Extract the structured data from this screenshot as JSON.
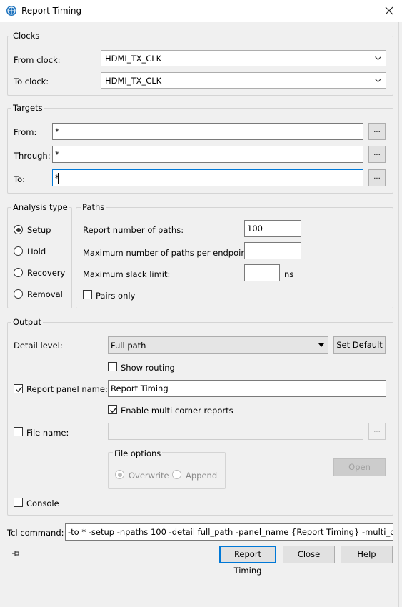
{
  "window": {
    "title": "Report Timing",
    "icon": "globe-app-icon",
    "close_icon": "close-icon"
  },
  "clocks": {
    "legend": "Clocks",
    "from_label": "From clock:",
    "from_value": "HDMI_TX_CLK",
    "to_label": "To clock:",
    "to_value": "HDMI_TX_CLK"
  },
  "targets": {
    "legend": "Targets",
    "from_label": "From:",
    "from_value": "*",
    "through_label": "Through:",
    "through_value": "*",
    "to_label": "To:",
    "to_value": "*",
    "browse_label": "..."
  },
  "analysis": {
    "legend": "Analysis type",
    "options": [
      "Setup",
      "Hold",
      "Recovery",
      "Removal"
    ],
    "selected": "Setup"
  },
  "paths": {
    "legend": "Paths",
    "report_number_label": "Report number of paths:",
    "report_number_value": "100",
    "max_per_endpoint_label": "Maximum number of paths per endpoint:",
    "max_per_endpoint_value": "",
    "max_slack_label": "Maximum slack limit:",
    "max_slack_value": "",
    "max_slack_unit": "ns",
    "pairs_only_label": "Pairs only",
    "pairs_only_checked": false
  },
  "output": {
    "legend": "Output",
    "detail_label": "Detail level:",
    "detail_value": "Full path",
    "set_default_label": "Set Default",
    "show_routing_label": "Show routing",
    "show_routing_checked": false,
    "report_panel_label": "Report panel name:",
    "report_panel_checked": true,
    "report_panel_value": "Report Timing",
    "multi_corner_label": "Enable multi corner reports",
    "multi_corner_checked": true,
    "file_name_label": "File name:",
    "file_name_checked": false,
    "file_name_value": "",
    "file_options_legend": "File options",
    "overwrite_label": "Overwrite",
    "append_label": "Append",
    "file_option_selected": "Overwrite",
    "open_label": "Open",
    "console_label": "Console",
    "console_checked": false
  },
  "tcl": {
    "label": "Tcl command:",
    "value": "-to * -setup -npaths 100 -detail full_path -panel_name {Report Timing} -multi_corner"
  },
  "footer": {
    "pin_icon": "pin-icon",
    "report_timing_label": "Report Timing",
    "close_label": "Close",
    "help_label": "Help"
  },
  "colors": {
    "focus": "#0078d7",
    "background": "#f0f0f0"
  }
}
